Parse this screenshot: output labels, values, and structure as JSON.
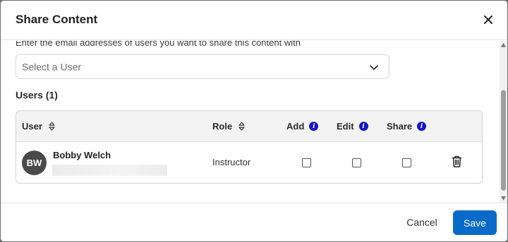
{
  "dialog": {
    "title": "Share Content",
    "close_icon": "close-icon"
  },
  "form": {
    "instruction": "Enter the email addresses of users you want to share this content with",
    "select_placeholder": "Select a User",
    "chevron_icon": "chevron-down-icon"
  },
  "users": {
    "heading": "Users (1)",
    "columns": [
      {
        "label": "User",
        "icon": "sort-icon"
      },
      {
        "label": "Role",
        "icon": "sort-icon"
      },
      {
        "label": "Add",
        "icon": "info-icon"
      },
      {
        "label": "Edit",
        "icon": "info-icon"
      },
      {
        "label": "Share",
        "icon": "info-icon"
      }
    ],
    "rows": [
      {
        "initials": "BW",
        "name": "Bobby Welch",
        "role": "Instructor",
        "add": false,
        "edit": false,
        "share": false,
        "delete_icon": "trash-icon"
      }
    ]
  },
  "footer": {
    "cancel_label": "Cancel",
    "save_label": "Save"
  },
  "colors": {
    "primary": "#0a6ac8",
    "info_icon": "#1414c8",
    "avatar_bg": "#4a4a4a"
  }
}
